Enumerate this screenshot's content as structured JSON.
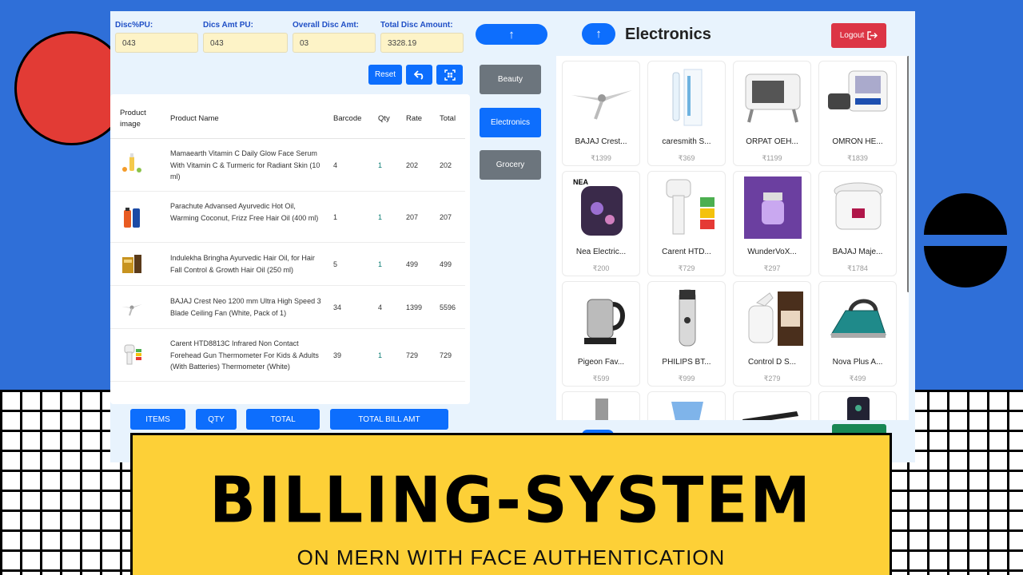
{
  "discounts": [
    {
      "label": "Disc%PU:",
      "value": "043"
    },
    {
      "label": "Dics Amt PU:",
      "value": "043"
    },
    {
      "label": "Overall Disc Amt:",
      "value": "03"
    },
    {
      "label": "Total Disc Amount:",
      "value": "3328.19"
    }
  ],
  "toolbar": {
    "reset": "Reset"
  },
  "bill": {
    "columns": {
      "image": "Product image",
      "name": "Product Name",
      "barcode": "Barcode",
      "qty": "Qty",
      "rate": "Rate",
      "total": "Total"
    },
    "rows": [
      {
        "name": "Mamaearth Vitamin C Daily Glow Face Serum With Vitamin C & Turmeric for Radiant Skin (10 ml)",
        "barcode": "4",
        "qty": "1",
        "rate": "202",
        "total": "202"
      },
      {
        "name": "Parachute Advansed Ayurvedic Hot Oil, Warming Coconut, Frizz Free Hair Oil (400 ml)",
        "barcode": "1",
        "qty": "1",
        "rate": "207",
        "total": "207"
      },
      {
        "name": "Indulekha Bringha Ayurvedic Hair Oil, for Hair Fall Control & Growth Hair Oil (250 ml)",
        "barcode": "5",
        "qty": "1",
        "rate": "499",
        "total": "499"
      },
      {
        "name": "BAJAJ Crest Neo 1200 mm Ultra High Speed 3 Blade Ceiling Fan (White, Pack of 1)",
        "barcode": "34",
        "qty": "4",
        "rate": "1399",
        "total": "5596"
      },
      {
        "name": "Carent HTD8813C Infrared Non Contact Forehead Gun Thermometer For Kids & Adults (With Batteries) Thermometer (White)",
        "barcode": "39",
        "qty": "1",
        "rate": "729",
        "total": "729"
      }
    ]
  },
  "totals": {
    "items": "ITEMS",
    "qty": "QTY",
    "total": "TOTAL",
    "bill": "TOTAL BILL AMT"
  },
  "arrow": "↑",
  "categories": [
    "Beauty",
    "Electronics",
    "Grocery"
  ],
  "active_category": "Electronics",
  "logout": "Logout",
  "products": [
    {
      "name": "BAJAJ Crest...",
      "price": "₹1399"
    },
    {
      "name": "caresmith S...",
      "price": "₹369"
    },
    {
      "name": "ORPAT OEH...",
      "price": "₹1199"
    },
    {
      "name": "OMRON HE...",
      "price": "₹1839"
    },
    {
      "name": "Nea Electric...",
      "price": "₹200"
    },
    {
      "name": "Carent HTD...",
      "price": "₹729"
    },
    {
      "name": "WunderVoX...",
      "price": "₹297"
    },
    {
      "name": "BAJAJ Maje...",
      "price": "₹1784"
    },
    {
      "name": "Pigeon Fav...",
      "price": "₹599"
    },
    {
      "name": "PHILIPS BT...",
      "price": "₹999"
    },
    {
      "name": "Control D S...",
      "price": "₹279"
    },
    {
      "name": "Nova Plus A...",
      "price": "₹499"
    }
  ],
  "banner": {
    "title": "BILLING-SYSTEM",
    "subtitle": "ON MERN WITH FACE AUTHENTICATION"
  }
}
